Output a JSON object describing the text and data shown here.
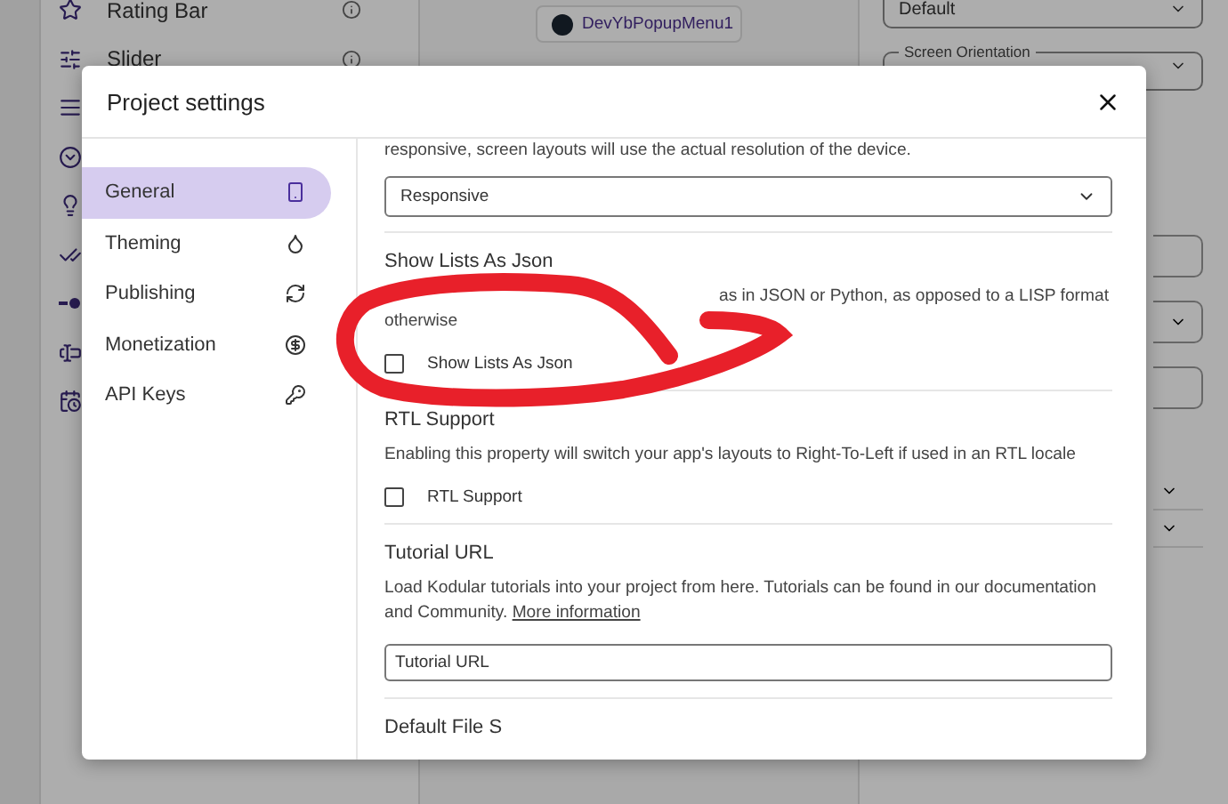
{
  "background": {
    "palette": [
      {
        "label": "Rating Bar"
      },
      {
        "label": "Slider"
      }
    ],
    "viewer": {
      "components": [
        "DevYbPopupMenu1"
      ]
    },
    "properties": {
      "fields": [
        {
          "value": "Default"
        },
        {
          "label": "Screen Orientation"
        }
      ]
    }
  },
  "dialog": {
    "title": "Project settings",
    "nav": [
      {
        "label": "General",
        "selected": true
      },
      {
        "label": "Theming",
        "selected": false
      },
      {
        "label": "Publishing",
        "selected": false
      },
      {
        "label": "Monetization",
        "selected": false
      },
      {
        "label": "API Keys",
        "selected": false
      }
    ],
    "sections": [
      {
        "kind": "select",
        "description": "responsive, screen layouts will use the actual resolution of the device.",
        "value": "Responsive"
      },
      {
        "kind": "checkbox",
        "heading": "Show Lists As Json",
        "description": "as in JSON or Python, as opposed to a LISP format otherwise",
        "obscured": true,
        "label": "Show Lists As Json",
        "checked": false
      },
      {
        "kind": "checkbox",
        "heading": "RTL Support",
        "description": "Enabling this property will switch your app's layouts to Right-To-Left if used in an RTL locale",
        "obscured": false,
        "label": "RTL Support",
        "checked": false
      },
      {
        "kind": "input",
        "heading": "Tutorial URL",
        "description": "Load Kodular tutorials into your project from here. Tutorials can be found in our documentation and Community.",
        "link": "More information",
        "placeholder": "Tutorial URL"
      },
      {
        "kind": "heading",
        "heading": "Default File S"
      }
    ]
  }
}
